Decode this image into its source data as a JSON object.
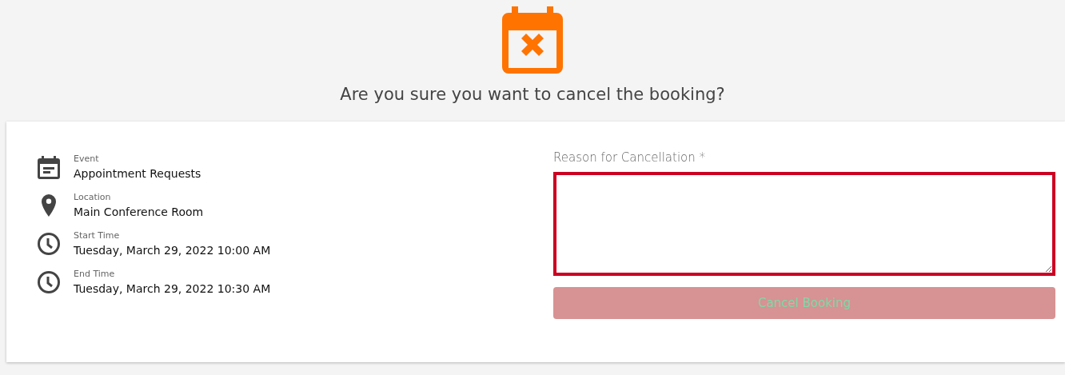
{
  "heading": "Are you sure you want to cancel the booking?",
  "details": [
    {
      "kind": "event",
      "label": "Event",
      "value": "Appointment Requests"
    },
    {
      "kind": "location",
      "label": "Location",
      "value": "Main Conference Room"
    },
    {
      "kind": "time",
      "label": "Start Time",
      "value": "Tuesday, March 29, 2022 10:00 AM"
    },
    {
      "kind": "time",
      "label": "End Time",
      "value": "Tuesday, March 29, 2022 10:30 AM"
    }
  ],
  "reason": {
    "label": "Reason for Cancellation *",
    "invalid": true
  },
  "submit": {
    "label": "Cancel Booking",
    "disabled": true
  }
}
